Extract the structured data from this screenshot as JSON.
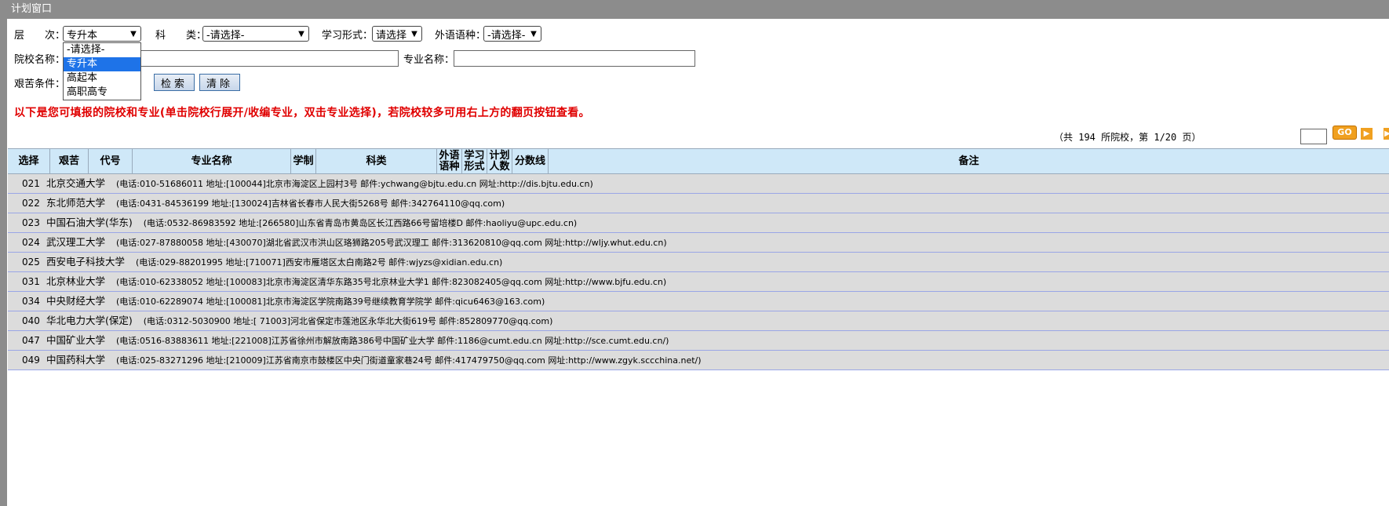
{
  "window": {
    "title": "计划窗口"
  },
  "filters": {
    "level_label": "层　　次：",
    "level_value": "专升本",
    "category_label": "科　　类：",
    "category_value": "-请选择-",
    "study_form_label": "学习形式：",
    "study_form_value": "请选择",
    "language_label": "外语语种：",
    "language_value": "-请选择-",
    "school_label": "院校名称：",
    "school_value": "",
    "major_label": "专业名称：",
    "major_value": "",
    "hardship_label": "艰苦条件：",
    "search_button": "检索",
    "clear_button": "清除"
  },
  "level_dropdown": {
    "options": [
      "-请选择-",
      "专升本",
      "高起本",
      "高职高专"
    ],
    "selected_index": 1
  },
  "notice": "以下是您可填报的院校和专业(单击院校行展开/收编专业，双击专业选择)，若院校较多可用右上方的翻页按钮查看。",
  "pagination": {
    "info": "（共 194 所院校，第 1/20 页）",
    "page_input": "",
    "go_label": "GO",
    "next_icon": "chevron-right-icon"
  },
  "table": {
    "headers": [
      "选择",
      "艰苦",
      "代号",
      "专业名称",
      "学制",
      "科类",
      "外语\n语种",
      "学习\n形式",
      "计划\n人数",
      "分数线",
      "备注"
    ],
    "rows": [
      {
        "code": "021",
        "name": "北京交通大学",
        "info": "(电话:010-51686011  地址:[100044]北京市海淀区上园村3号  邮件:ychwang@bjtu.edu.cn  网址:http://dis.bjtu.edu.cn)"
      },
      {
        "code": "022",
        "name": "东北师范大学",
        "info": "(电话:0431-84536199  地址:[130024]吉林省长春市人民大街5268号  邮件:342764110@qq.com)"
      },
      {
        "code": "023",
        "name": "中国石油大学(华东)",
        "info": "(电话:0532-86983592  地址:[266580]山东省青岛市黄岛区长江西路66号留培楼D  邮件:haoliyu@upc.edu.cn)"
      },
      {
        "code": "024",
        "name": "武汉理工大学",
        "info": "(电话:027-87880058  地址:[430070]湖北省武汉市洪山区珞狮路205号武汉理工  邮件:313620810@qq.com  网址:http://wljy.whut.edu.cn)"
      },
      {
        "code": "025",
        "name": "西安电子科技大学",
        "info": "(电话:029-88201995  地址:[710071]西安市雁塔区太白南路2号  邮件:wjyzs@xidian.edu.cn)"
      },
      {
        "code": "031",
        "name": "北京林业大学",
        "info": "(电话:010-62338052  地址:[100083]北京市海淀区清华东路35号北京林业大学1  邮件:823082405@qq.com  网址:http://www.bjfu.edu.cn)"
      },
      {
        "code": "034",
        "name": "中央财经大学",
        "info": "(电话:010-62289074  地址:[100081]北京市海淀区学院南路39号继续教育学院学  邮件:qicu6463@163.com)"
      },
      {
        "code": "040",
        "name": "华北电力大学(保定)",
        "info": "(电话:0312-5030900  地址:[ 71003]河北省保定市莲池区永华北大街619号  邮件:852809770@qq.com)"
      },
      {
        "code": "047",
        "name": "中国矿业大学",
        "info": "(电话:0516-83883611  地址:[221008]江苏省徐州市解放南路386号中国矿业大学  邮件:1186@cumt.edu.cn  网址:http://sce.cumt.edu.cn/)"
      },
      {
        "code": "049",
        "name": "中国药科大学",
        "info": "(电话:025-83271296  地址:[210009]江苏省南京市鼓楼区中央门街道童家巷24号  邮件:417479750@qq.com  网址:http://www.zgyk.sccchina.net/)"
      }
    ]
  }
}
